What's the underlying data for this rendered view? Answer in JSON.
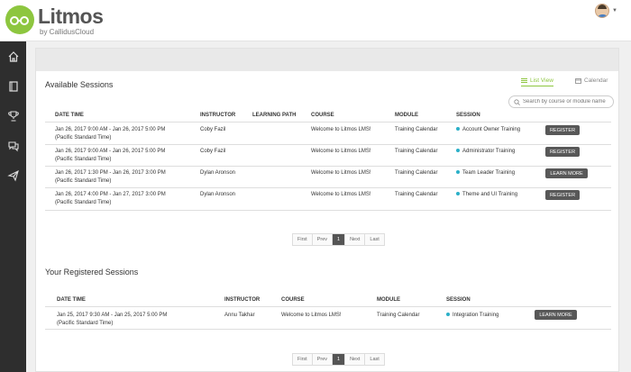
{
  "header": {
    "brand": "Litmos",
    "brand_sub": "by CallidusCloud"
  },
  "sidebar": {
    "items": [
      {
        "icon": "home-icon"
      },
      {
        "icon": "book-icon"
      },
      {
        "icon": "trophy-icon"
      },
      {
        "icon": "chat-icon"
      },
      {
        "icon": "paper-plane-icon"
      }
    ]
  },
  "available": {
    "title": "Available Sessions",
    "tabs": {
      "list": "List View",
      "calendar": "Calendar"
    },
    "search_placeholder": "Search by course or module name",
    "columns": [
      "DATE TIME",
      "INSTRUCTOR",
      "LEARNING PATH",
      "COURSE",
      "MODULE",
      "SESSION"
    ],
    "rows": [
      {
        "date1": "Jan 26, 2017 9:00 AM - Jan 26, 2017 5:00 PM",
        "date2": "(Pacific Standard Time)",
        "instructor": "Coby Fazil",
        "path": "",
        "course": "Welcome to Litmos LMS!",
        "module": "Training Calendar",
        "session": "Account Owner Training",
        "action": "REGISTER"
      },
      {
        "date1": "Jan 26, 2017 9:00 AM - Jan 26, 2017 5:00 PM",
        "date2": "(Pacific Standard Time)",
        "instructor": "Coby Fazil",
        "path": "",
        "course": "Welcome to Litmos LMS!",
        "module": "Training Calendar",
        "session": "Administrator Training",
        "action": "REGISTER"
      },
      {
        "date1": "Jan 26, 2017 1:30 PM - Jan 26, 2017 3:00 PM",
        "date2": "(Pacific Standard Time)",
        "instructor": "Dylan Aronson",
        "path": "",
        "course": "Welcome to Litmos LMS!",
        "module": "Training Calendar",
        "session": "Team Leader Training",
        "action": "LEARN MORE"
      },
      {
        "date1": "Jan 26, 2017 4:00 PM - Jan 27, 2017 3:00 PM",
        "date2": "(Pacific Standard Time)",
        "instructor": "Dylan Aronson",
        "path": "",
        "course": "Welcome to Litmos LMS!",
        "module": "Training Calendar",
        "session": "Theme and UI Training",
        "action": "REGISTER"
      }
    ],
    "pager": {
      "first": "First",
      "prev": "Prev",
      "page": "1",
      "next": "Next",
      "last": "Last"
    }
  },
  "registered": {
    "title": "Your Registered Sessions",
    "columns": [
      "DATE TIME",
      "INSTRUCTOR",
      "COURSE",
      "MODULE",
      "SESSION"
    ],
    "rows": [
      {
        "date1": "Jan 25, 2017 9:30 AM - Jan 25, 2017 5:00 PM",
        "date2": "(Pacific Standard Time)",
        "instructor": "Annu Takhar",
        "course": "Welcome to Litmos LMS!",
        "module": "Training Calendar",
        "session": "Integration Training",
        "action": "LEARN MORE"
      }
    ],
    "pager": {
      "first": "First",
      "prev": "Prev",
      "page": "1",
      "next": "Next",
      "last": "Last"
    }
  },
  "colors": {
    "accent": "#8dc63f",
    "session_dot": "#2bb0c8",
    "button": "#585858",
    "sidebar": "#2e2e2e"
  }
}
